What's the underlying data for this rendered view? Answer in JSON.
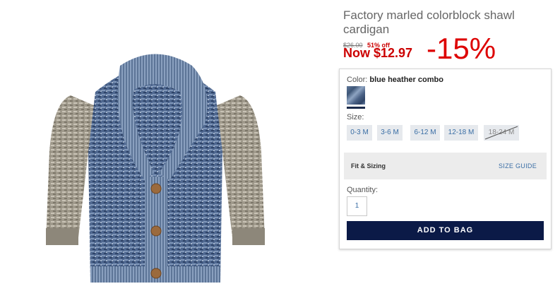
{
  "product": {
    "title": "Factory marled colorblock shawl cardigan",
    "original_price": "$26.00",
    "percent_off": "51% off",
    "now_price": "Now $12.97",
    "discount_badge": "-15%"
  },
  "panel": {
    "color_label": "Color:",
    "color_value": "blue heather combo",
    "size_label": "Size:",
    "sizes": [
      {
        "label": "0-3 M",
        "available": true
      },
      {
        "label": "3-6 M",
        "available": true
      },
      {
        "label": "6-12 M",
        "available": true
      },
      {
        "label": "12-18 M",
        "available": true
      },
      {
        "label": "18-24 M",
        "available": false
      }
    ],
    "fit_label": "Fit & Sizing",
    "size_guide": "SIZE GUIDE",
    "quantity_label": "Quantity:",
    "quantity_value": "1",
    "add_to_bag": "ADD TO BAG"
  },
  "colors": {
    "sale_red": "#dd0000",
    "navy": "#0b1a47",
    "link_blue": "#3a6ea5"
  }
}
